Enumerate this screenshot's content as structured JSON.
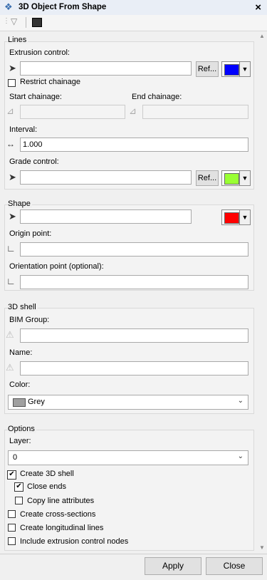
{
  "window": {
    "title": "3D Object From Shape"
  },
  "lines": {
    "header": "Lines",
    "extrusion_label": "Extrusion control:",
    "extrusion_value": "",
    "ref_label": "Ref...",
    "extrusion_color": "#0000ff",
    "restrict_label": "Restrict chainage",
    "restrict_checked": false,
    "start_label": "Start chainage:",
    "end_label": "End chainage:",
    "interval_label": "Interval:",
    "interval_value": "1.000",
    "grade_label": "Grade control:",
    "grade_value": "",
    "grade_color": "#99ff33"
  },
  "shape": {
    "header": "Shape",
    "shape_value": "",
    "shape_color": "#ff0000",
    "origin_label": "Origin point:",
    "orientation_label": "Orientation point (optional):"
  },
  "shell": {
    "header": "3D shell",
    "bim_label": "BIM Group:",
    "name_label": "Name:",
    "color_label": "Color:",
    "color_value": "Grey",
    "color_swatch": "#a0a0a0"
  },
  "options": {
    "header": "Options",
    "layer_label": "Layer:",
    "layer_value": "0",
    "create_shell": "Create 3D shell",
    "close_ends": "Close ends",
    "copy_attrs": "Copy line attributes",
    "cross_sections": "Create cross-sections",
    "longitudinal": "Create longitudinal lines",
    "include_nodes": "Include extrusion control nodes"
  },
  "buttons": {
    "apply": "Apply",
    "close": "Close"
  }
}
